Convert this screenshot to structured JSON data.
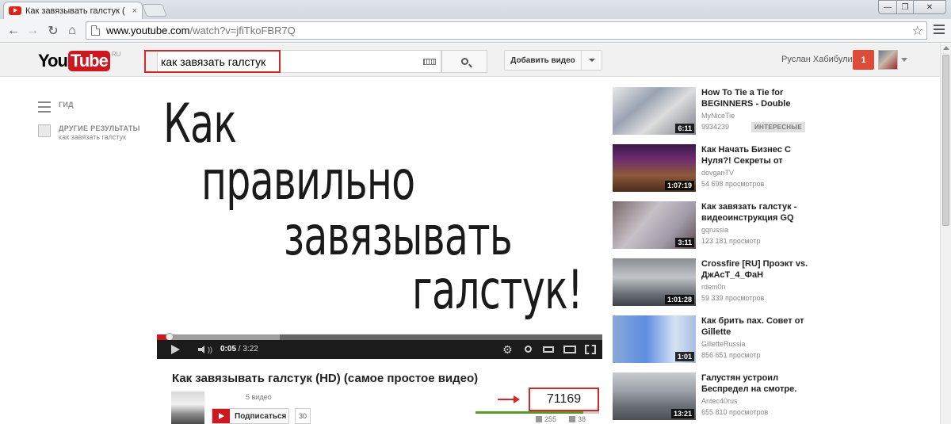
{
  "browser": {
    "tab_title": "Как завязывать галстук (",
    "tab_close": "×",
    "url_host": "www.youtube.com",
    "url_rest": "/watch?v=jfiTkoFBR7Q",
    "win_min": "—",
    "win_max": "❐",
    "win_close": "✕"
  },
  "header": {
    "logo_you": "You",
    "logo_tube": "Tube",
    "logo_region": "RU",
    "search_value": "как завязать галстук",
    "upload_label": "Добавить видео",
    "username": "Руслан Хабибулин",
    "notifications": "1"
  },
  "guide": {
    "guide_label": "ГИД",
    "more_label": "ДРУГИЕ РЕЗУЛЬТАТЫ",
    "more_sub": "как завязать галстук"
  },
  "player": {
    "poster_lines": [
      "Как",
      "правильно",
      "завязывать",
      "галстук!"
    ],
    "time_current": "0:05",
    "time_total": "/ 3:22",
    "played_fraction": 0.0247
  },
  "watch": {
    "title": "Как завязывать галстук (HD) (самое простое видео)",
    "video_count": "5 видео",
    "subscribe_label": "Подписаться",
    "subscriber_count": "30",
    "views": "71169",
    "likes": "255",
    "dislikes": "38"
  },
  "related": [
    {
      "title": "How To Tie a Tie for BEGINNERS - Double",
      "channel": "MyNiceTie",
      "views": "9934239",
      "duration": "6:11",
      "badge": "ИНТЕРЕСНЫЕ"
    },
    {
      "title": "Как Начать Бизнес С Нуля?! Секреты от",
      "channel": "dovganTV",
      "views": "54 698 просмотров",
      "duration": "1:07:19"
    },
    {
      "title": "Как завязать галстук - видеоинструкция GQ",
      "channel": "gqrussia",
      "views": "123 181 просмотр",
      "duration": "3:11"
    },
    {
      "title": "Crossfire [RU] Проэкт vs. ДжАсТ_4_ФаН",
      "channel": "rdem0n",
      "views": "59 339 просмотров",
      "duration": "1:01:28"
    },
    {
      "title": "Как брить пах. Совет от Gillette",
      "channel": "GilletteRussia",
      "views": "856 651 просмотр",
      "duration": "1:01"
    },
    {
      "title": "Галустян устроил Беспредел на смотре.",
      "channel": "Antec40rus",
      "views": "655 810 просмотров",
      "duration": "13:21"
    }
  ],
  "colors": {
    "yt_red": "#cc181e",
    "highlight_red": "#d42828",
    "like_green": "#589b2a"
  }
}
